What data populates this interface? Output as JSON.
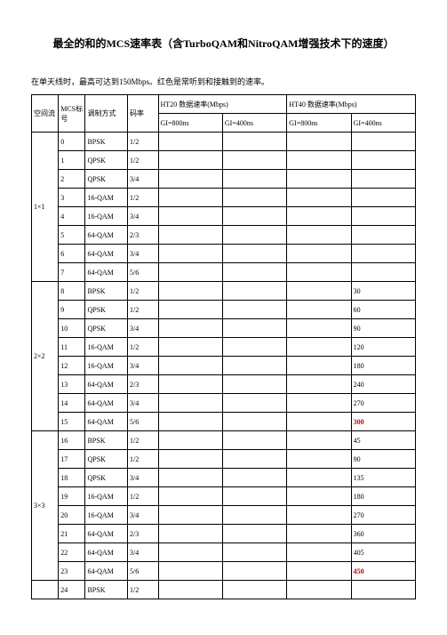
{
  "title": "最全的和的MCS速率表（含TurboQAM和NitroQAM增强技术下的速度）",
  "note": "在单天线时，最高可达到150Mbps。红色是常听到和接触到的速率。",
  "headers": {
    "c1": "空间流",
    "c2": "MCS标号",
    "c3": "调制方式",
    "c4": "码率",
    "ht20": "HT20 数据速率(Mbps)",
    "ht40": "HT40 数据速率(Mbps)",
    "gi800": "GI=800ns",
    "gi400": "GI=400ns"
  },
  "groups": [
    {
      "stream": "1×1",
      "rows": [
        {
          "mcs": "0",
          "mod": "BPSK",
          "rate": "1/2",
          "a": "",
          "b": "",
          "c": "",
          "d": ""
        },
        {
          "mcs": "1",
          "mod": "QPSK",
          "rate": "1/2",
          "a": "",
          "b": "",
          "c": "",
          "d": ""
        },
        {
          "mcs": "2",
          "mod": "QPSK",
          "rate": "3/4",
          "a": "",
          "b": "",
          "c": "",
          "d": ""
        },
        {
          "mcs": "3",
          "mod": "16-QAM",
          "rate": "1/2",
          "a": "",
          "b": "",
          "c": "",
          "d": ""
        },
        {
          "mcs": "4",
          "mod": "16-QAM",
          "rate": "3/4",
          "a": "",
          "b": "",
          "c": "",
          "d": ""
        },
        {
          "mcs": "5",
          "mod": "64-QAM",
          "rate": "2/3",
          "a": "",
          "b": "",
          "c": "",
          "d": ""
        },
        {
          "mcs": "6",
          "mod": "64-QAM",
          "rate": "3/4",
          "a": "",
          "b": "",
          "c": "",
          "d": ""
        },
        {
          "mcs": "7",
          "mod": "64-QAM",
          "rate": "5/6",
          "a": "",
          "b": "",
          "c": "",
          "d": ""
        }
      ]
    },
    {
      "stream": "2×2",
      "rows": [
        {
          "mcs": "8",
          "mod": "BPSK",
          "rate": "1/2",
          "a": "",
          "b": "",
          "c": "",
          "d": "30"
        },
        {
          "mcs": "9",
          "mod": "QPSK",
          "rate": "1/2",
          "a": "",
          "b": "",
          "c": "",
          "d": "60"
        },
        {
          "mcs": "10",
          "mod": "QPSK",
          "rate": "3/4",
          "a": "",
          "b": "",
          "c": "",
          "d": "90"
        },
        {
          "mcs": "11",
          "mod": "16-QAM",
          "rate": "1/2",
          "a": "",
          "b": "",
          "c": "",
          "d": "120"
        },
        {
          "mcs": "12",
          "mod": "16-QAM",
          "rate": "3/4",
          "a": "",
          "b": "",
          "c": "",
          "d": "180"
        },
        {
          "mcs": "13",
          "mod": "64-QAM",
          "rate": "2/3",
          "a": "",
          "b": "",
          "c": "",
          "d": "240"
        },
        {
          "mcs": "14",
          "mod": "64-QAM",
          "rate": "3/4",
          "a": "",
          "b": "",
          "c": "",
          "d": "270"
        },
        {
          "mcs": "15",
          "mod": "64-QAM",
          "rate": "5/6",
          "a": "",
          "b": "",
          "c": "",
          "d": "300",
          "red": true
        }
      ]
    },
    {
      "stream": "3×3",
      "rows": [
        {
          "mcs": "16",
          "mod": "BPSK",
          "rate": "1/2",
          "a": "",
          "b": "",
          "c": "",
          "d": "45"
        },
        {
          "mcs": "17",
          "mod": "QPSK",
          "rate": "1/2",
          "a": "",
          "b": "",
          "c": "",
          "d": "90"
        },
        {
          "mcs": "18",
          "mod": "QPSK",
          "rate": "3/4",
          "a": "",
          "b": "",
          "c": "",
          "d": "135"
        },
        {
          "mcs": "19",
          "mod": "16-QAM",
          "rate": "1/2",
          "a": "",
          "b": "",
          "c": "",
          "d": "180"
        },
        {
          "mcs": "20",
          "mod": "16-QAM",
          "rate": "3/4",
          "a": "",
          "b": "",
          "c": "",
          "d": "270"
        },
        {
          "mcs": "21",
          "mod": "64-QAM",
          "rate": "2/3",
          "a": "",
          "b": "",
          "c": "",
          "d": "360"
        },
        {
          "mcs": "22",
          "mod": "64-QAM",
          "rate": "3/4",
          "a": "",
          "b": "",
          "c": "",
          "d": "405"
        },
        {
          "mcs": "23",
          "mod": "64-QAM",
          "rate": "5/6",
          "a": "",
          "b": "",
          "c": "",
          "d": "450",
          "red": true
        }
      ]
    },
    {
      "stream": "",
      "rows": [
        {
          "mcs": "24",
          "mod": "BPSK",
          "rate": "1/2",
          "a": "",
          "b": "",
          "c": "",
          "d": ""
        }
      ]
    }
  ]
}
